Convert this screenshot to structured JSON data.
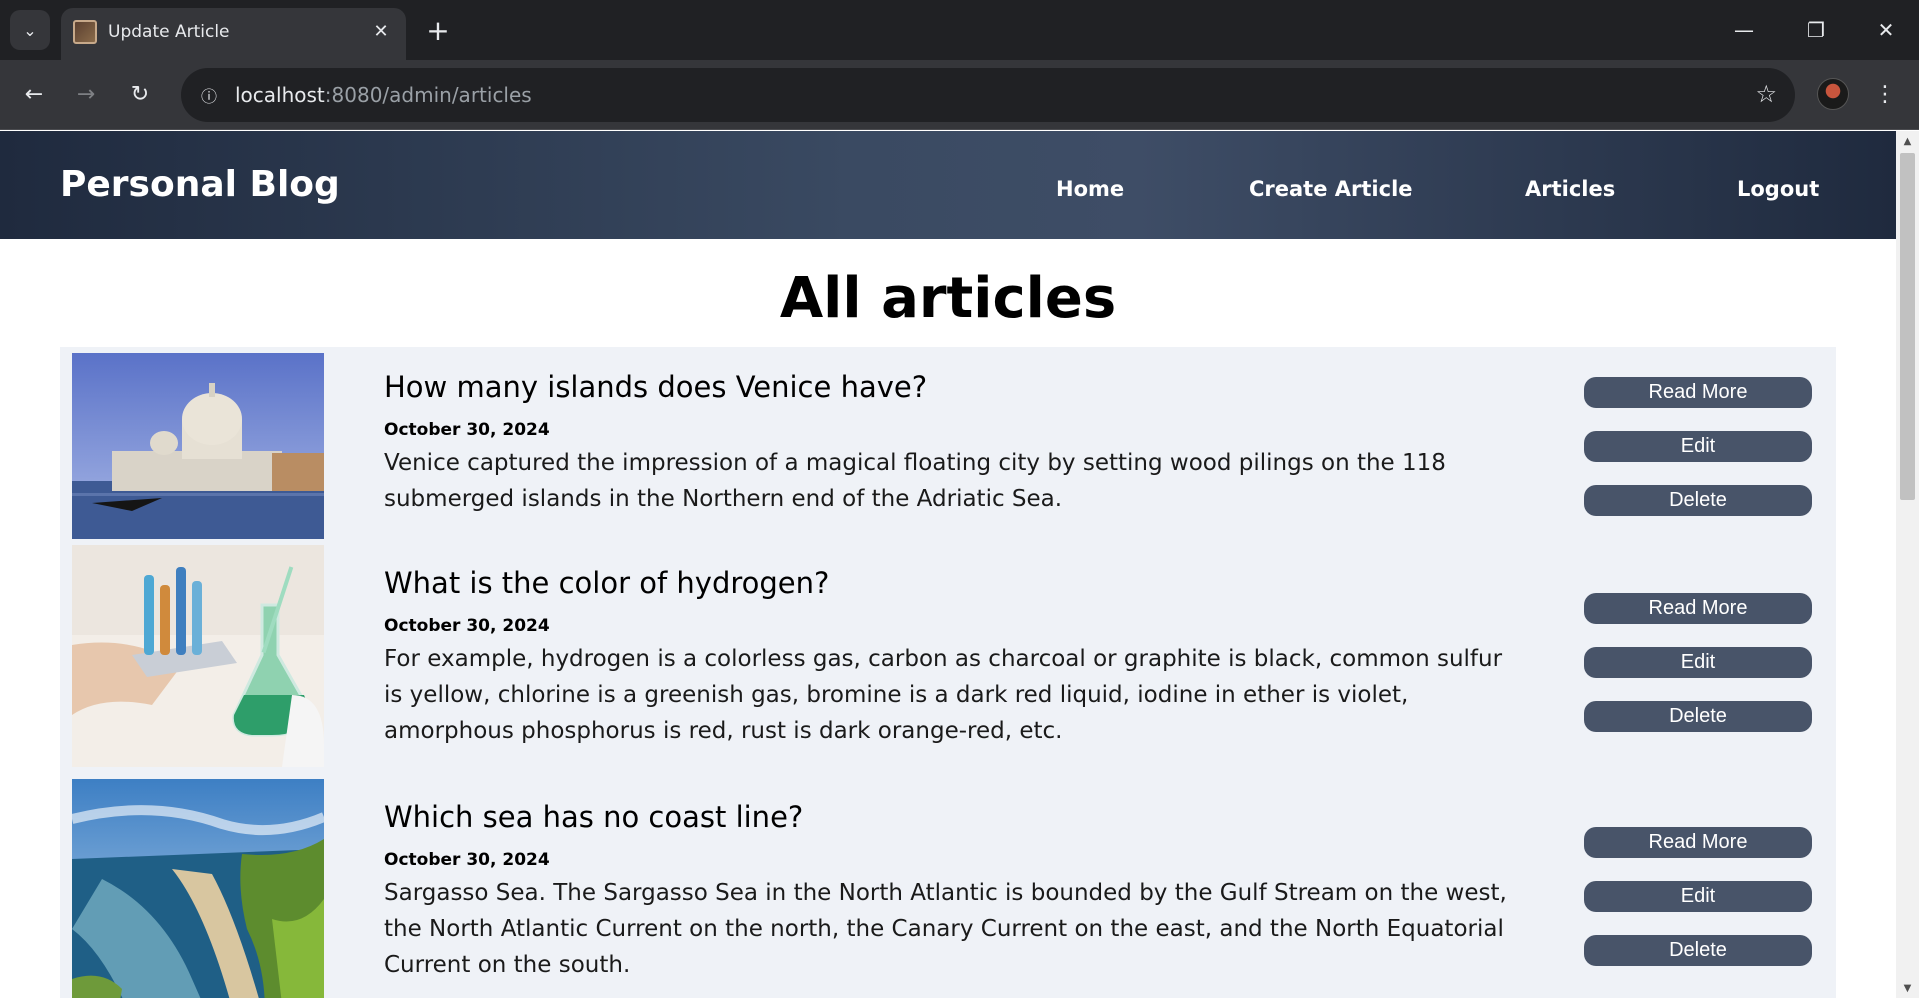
{
  "browser": {
    "tab_title": "Update Article",
    "url_host": "localhost",
    "url_path": ":8080/admin/articles"
  },
  "site": {
    "brand": "Personal Blog",
    "nav": [
      {
        "label": "Home"
      },
      {
        "label": "Create Article"
      },
      {
        "label": "Articles"
      },
      {
        "label": "Logout"
      }
    ]
  },
  "page": {
    "title": "All articles"
  },
  "articles": [
    {
      "title": "How many islands does Venice have?",
      "date": "October 30, 2024",
      "excerpt": "Venice captured the impression of a magical floating city by setting wood pilings on the 118 submerged islands in the Northern end of the Adriatic Sea.",
      "image": "venice-photo"
    },
    {
      "title": "What is the color of hydrogen?",
      "date": "October 30, 2024",
      "excerpt": "For example, hydrogen is a colorless gas, carbon as charcoal or graphite is black, common sulfur is yellow, chlorine is a greenish gas, bromine is a dark red liquid, iodine in ether is violet, amorphous phosphorus is red, rust is dark orange-red, etc.",
      "image": "lab-flasks-photo"
    },
    {
      "title": "Which sea has no coast line?",
      "date": "October 30, 2024",
      "excerpt": "Sargasso Sea. The Sargasso Sea in the North Atlantic is bounded by the Gulf Stream on the west, the North Atlantic Current on the north, the Canary Current on the east, and the North Equatorial Current on the south.",
      "image": "coastline-photo"
    }
  ],
  "actions": {
    "read_more": "Read More",
    "edit": "Edit",
    "delete": "Delete"
  }
}
